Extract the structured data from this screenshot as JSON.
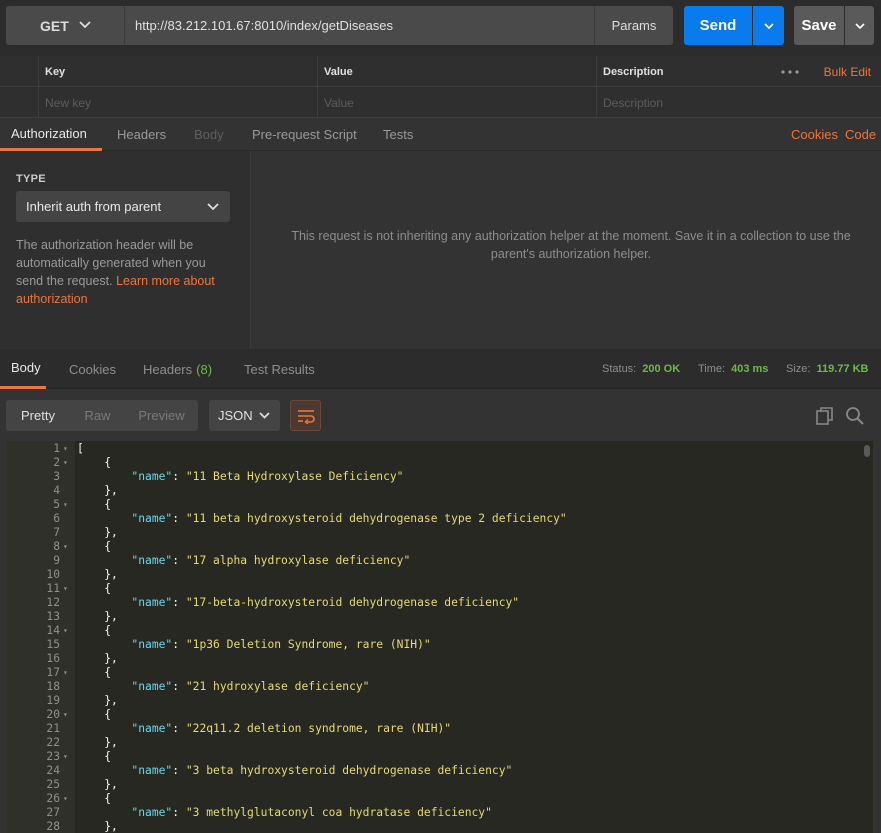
{
  "request": {
    "method": "GET",
    "url": "http://83.212.101.67:8010/index/getDiseases",
    "params_label": "Params",
    "send_label": "Send",
    "save_label": "Save"
  },
  "params_table": {
    "headers": [
      "Key",
      "Value",
      "Description"
    ],
    "placeholders": [
      "New key",
      "Value",
      "Description"
    ],
    "bulk_edit": "Bulk Edit"
  },
  "request_tabs": {
    "items": [
      "Authorization",
      "Headers",
      "Body",
      "Pre-request Script",
      "Tests"
    ],
    "active": "Authorization",
    "right_links": [
      "Cookies",
      "Code"
    ]
  },
  "auth": {
    "type_label": "TYPE",
    "selected_type": "Inherit auth from parent",
    "description": "The authorization header will be automatically generated when you send the request.",
    "learn_more": "Learn more about authorization",
    "message": "This request is not inheriting any authorization helper at the moment. Save it in a collection to use the parent's authorization helper."
  },
  "response_tabs": {
    "items": [
      "Body",
      "Cookies",
      "Headers",
      "Test Results"
    ],
    "headers_count": "(8)",
    "active": "Body",
    "status_label": "Status:",
    "status_value": "200 OK",
    "time_label": "Time:",
    "time_value": "403 ms",
    "size_label": "Size:",
    "size_value": "119.77 KB"
  },
  "response_toolbar": {
    "formats": [
      "Pretty",
      "Raw",
      "Preview"
    ],
    "active_format": "Pretty",
    "language": "JSON"
  },
  "code_lines": [
    {
      "n": "1",
      "fold": true,
      "indent": "",
      "pre": "[",
      "key": "",
      "val": "",
      "post": ""
    },
    {
      "n": "2",
      "fold": true,
      "indent": "    ",
      "pre": "{",
      "key": "",
      "val": "",
      "post": ""
    },
    {
      "n": "3",
      "fold": false,
      "indent": "        ",
      "pre": "",
      "key": "\"name\"",
      "val": "\"11 Beta Hydroxylase Deficiency\"",
      "post": ""
    },
    {
      "n": "4",
      "fold": false,
      "indent": "    ",
      "pre": "},",
      "key": "",
      "val": "",
      "post": ""
    },
    {
      "n": "5",
      "fold": true,
      "indent": "    ",
      "pre": "{",
      "key": "",
      "val": "",
      "post": ""
    },
    {
      "n": "6",
      "fold": false,
      "indent": "        ",
      "pre": "",
      "key": "\"name\"",
      "val": "\"11 beta hydroxysteroid dehydrogenase type 2 deficiency\"",
      "post": ""
    },
    {
      "n": "7",
      "fold": false,
      "indent": "    ",
      "pre": "},",
      "key": "",
      "val": "",
      "post": ""
    },
    {
      "n": "8",
      "fold": true,
      "indent": "    ",
      "pre": "{",
      "key": "",
      "val": "",
      "post": ""
    },
    {
      "n": "9",
      "fold": false,
      "indent": "        ",
      "pre": "",
      "key": "\"name\"",
      "val": "\"17 alpha hydroxylase deficiency\"",
      "post": ""
    },
    {
      "n": "10",
      "fold": false,
      "indent": "    ",
      "pre": "},",
      "key": "",
      "val": "",
      "post": ""
    },
    {
      "n": "11",
      "fold": true,
      "indent": "    ",
      "pre": "{",
      "key": "",
      "val": "",
      "post": ""
    },
    {
      "n": "12",
      "fold": false,
      "indent": "        ",
      "pre": "",
      "key": "\"name\"",
      "val": "\"17-beta-hydroxysteroid dehydrogenase deficiency\"",
      "post": ""
    },
    {
      "n": "13",
      "fold": false,
      "indent": "    ",
      "pre": "},",
      "key": "",
      "val": "",
      "post": ""
    },
    {
      "n": "14",
      "fold": true,
      "indent": "    ",
      "pre": "{",
      "key": "",
      "val": "",
      "post": ""
    },
    {
      "n": "15",
      "fold": false,
      "indent": "        ",
      "pre": "",
      "key": "\"name\"",
      "val": "\"1p36 Deletion Syndrome, rare (NIH)\"",
      "post": ""
    },
    {
      "n": "16",
      "fold": false,
      "indent": "    ",
      "pre": "},",
      "key": "",
      "val": "",
      "post": ""
    },
    {
      "n": "17",
      "fold": true,
      "indent": "    ",
      "pre": "{",
      "key": "",
      "val": "",
      "post": ""
    },
    {
      "n": "18",
      "fold": false,
      "indent": "        ",
      "pre": "",
      "key": "\"name\"",
      "val": "\"21 hydroxylase deficiency\"",
      "post": ""
    },
    {
      "n": "19",
      "fold": false,
      "indent": "    ",
      "pre": "},",
      "key": "",
      "val": "",
      "post": ""
    },
    {
      "n": "20",
      "fold": true,
      "indent": "    ",
      "pre": "{",
      "key": "",
      "val": "",
      "post": ""
    },
    {
      "n": "21",
      "fold": false,
      "indent": "        ",
      "pre": "",
      "key": "\"name\"",
      "val": "\"22q11.2 deletion syndrome, rare (NIH)\"",
      "post": ""
    },
    {
      "n": "22",
      "fold": false,
      "indent": "    ",
      "pre": "},",
      "key": "",
      "val": "",
      "post": ""
    },
    {
      "n": "23",
      "fold": true,
      "indent": "    ",
      "pre": "{",
      "key": "",
      "val": "",
      "post": ""
    },
    {
      "n": "24",
      "fold": false,
      "indent": "        ",
      "pre": "",
      "key": "\"name\"",
      "val": "\"3 beta hydroxysteroid dehydrogenase deficiency\"",
      "post": ""
    },
    {
      "n": "25",
      "fold": false,
      "indent": "    ",
      "pre": "},",
      "key": "",
      "val": "",
      "post": ""
    },
    {
      "n": "26",
      "fold": true,
      "indent": "    ",
      "pre": "{",
      "key": "",
      "val": "",
      "post": ""
    },
    {
      "n": "27",
      "fold": false,
      "indent": "        ",
      "pre": "",
      "key": "\"name\"",
      "val": "\"3 methylglutaconyl coa hydratase deficiency\"",
      "post": ""
    },
    {
      "n": "28",
      "fold": false,
      "indent": "    ",
      "pre": "},",
      "key": "",
      "val": "",
      "post": ""
    }
  ],
  "colors": {
    "accent": "#f0743b",
    "send_button": "#097bed",
    "status_ok": "#6eb84a",
    "code_bg": "#272822",
    "json_key": "#66d9ef",
    "json_string": "#e6db74"
  }
}
